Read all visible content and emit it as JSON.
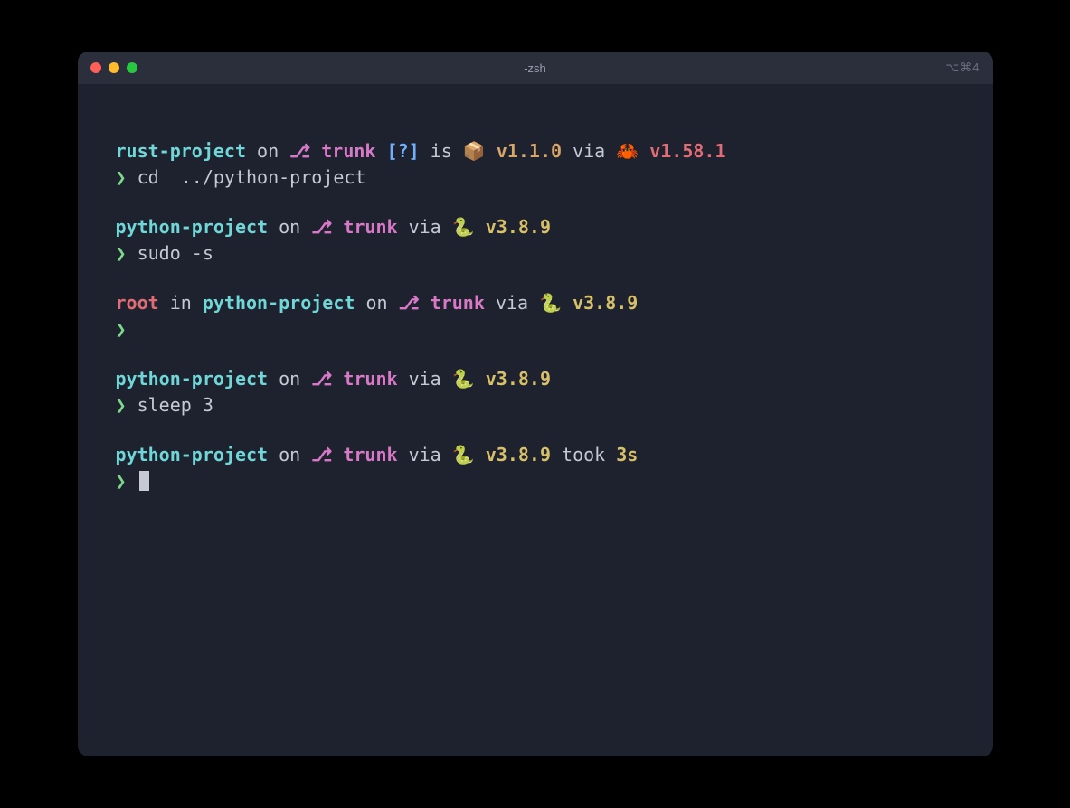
{
  "window": {
    "title": "-zsh",
    "shortcut_hint": "⌥⌘4"
  },
  "colors": {
    "bg": "#1e222e",
    "titlebar": "#2b2e3b",
    "dir": "#6fd7d7",
    "branch": "#d879c8",
    "bracket": "#6fb0ff",
    "pkg": "#d8a668",
    "ver_red": "#e06c75",
    "ver_yellow": "#d8c069",
    "prompt": "#7fd888",
    "root": "#e06c75",
    "text": "#c6c9d4"
  },
  "blocks": [
    {
      "segments": [
        {
          "t": "rust-project",
          "c": "dir"
        },
        {
          "t": " on ",
          "c": "muted"
        },
        {
          "t": "⎇ ",
          "c": "gicon"
        },
        {
          "t": "trunk",
          "c": "branch"
        },
        {
          "t": " ",
          "c": "muted"
        },
        {
          "t": "[?]",
          "c": "brack"
        },
        {
          "t": " is ",
          "c": "muted"
        },
        {
          "t": "📦 ",
          "c": "pkg"
        },
        {
          "t": "v1.1.0",
          "c": "pkg"
        },
        {
          "t": " via ",
          "c": "muted"
        },
        {
          "t": "🦀 ",
          "c": "ver-r"
        },
        {
          "t": "v1.58.1",
          "c": "ver-r"
        }
      ],
      "prompt": "❯",
      "cmd": "cd  ../python-project"
    },
    {
      "segments": [
        {
          "t": "python-project",
          "c": "dir"
        },
        {
          "t": " on ",
          "c": "muted"
        },
        {
          "t": "⎇ ",
          "c": "gicon"
        },
        {
          "t": "trunk",
          "c": "branch"
        },
        {
          "t": " via ",
          "c": "muted"
        },
        {
          "t": "🐍 ",
          "c": "ver-y"
        },
        {
          "t": "v3.8.9",
          "c": "ver-y"
        }
      ],
      "prompt": "❯",
      "cmd": "sudo -s"
    },
    {
      "segments": [
        {
          "t": "root",
          "c": "root"
        },
        {
          "t": " in ",
          "c": "muted"
        },
        {
          "t": "python-project",
          "c": "dir"
        },
        {
          "t": " on ",
          "c": "muted"
        },
        {
          "t": "⎇ ",
          "c": "gicon"
        },
        {
          "t": "trunk",
          "c": "branch"
        },
        {
          "t": " via ",
          "c": "muted"
        },
        {
          "t": "🐍 ",
          "c": "ver-y"
        },
        {
          "t": "v3.8.9",
          "c": "ver-y"
        }
      ],
      "prompt": "❯",
      "cmd": ""
    },
    {
      "segments": [
        {
          "t": "python-project",
          "c": "dir"
        },
        {
          "t": " on ",
          "c": "muted"
        },
        {
          "t": "⎇ ",
          "c": "gicon"
        },
        {
          "t": "trunk",
          "c": "branch"
        },
        {
          "t": " via ",
          "c": "muted"
        },
        {
          "t": "🐍 ",
          "c": "ver-y"
        },
        {
          "t": "v3.8.9",
          "c": "ver-y"
        }
      ],
      "prompt": "❯",
      "cmd": "sleep 3"
    },
    {
      "segments": [
        {
          "t": "python-project",
          "c": "dir"
        },
        {
          "t": " on ",
          "c": "muted"
        },
        {
          "t": "⎇ ",
          "c": "gicon"
        },
        {
          "t": "trunk",
          "c": "branch"
        },
        {
          "t": " via ",
          "c": "muted"
        },
        {
          "t": "🐍 ",
          "c": "ver-y"
        },
        {
          "t": "v3.8.9",
          "c": "ver-y"
        },
        {
          "t": " took ",
          "c": "muted"
        },
        {
          "t": "3s",
          "c": "yellow"
        }
      ],
      "prompt": "❯",
      "cmd": "",
      "cursor": true
    }
  ]
}
